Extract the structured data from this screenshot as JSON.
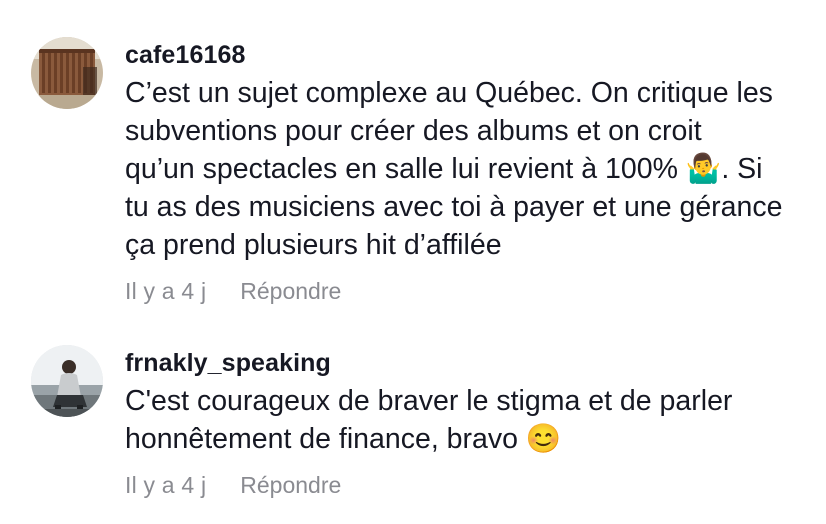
{
  "comments": [
    {
      "username": "cafe16168",
      "text": "C’est un sujet complexe au Québec. On critique les\nsubventions pour créer des albums et on croit\nqu’un spectacles en salle lui revient à 100% 🤷‍♂️. Si\ntu as des musiciens avec toi à payer et une gérance\nça prend plusieurs hit d’affilée",
      "time": "Il y a 4 j",
      "reply_label": "Répondre",
      "avatar_icon": "avatar-photo-wooden-fence"
    },
    {
      "username": "frnakly_speaking",
      "text": "C'est courageux de braver le stigma et de parler\nhonnêtement de finance, bravo 😊",
      "time": "Il y a 4 j",
      "reply_label": "Répondre",
      "avatar_icon": "avatar-photo-person-seated"
    }
  ],
  "colors": {
    "text": "#161823",
    "meta": "#8a8b91",
    "background": "#ffffff"
  }
}
